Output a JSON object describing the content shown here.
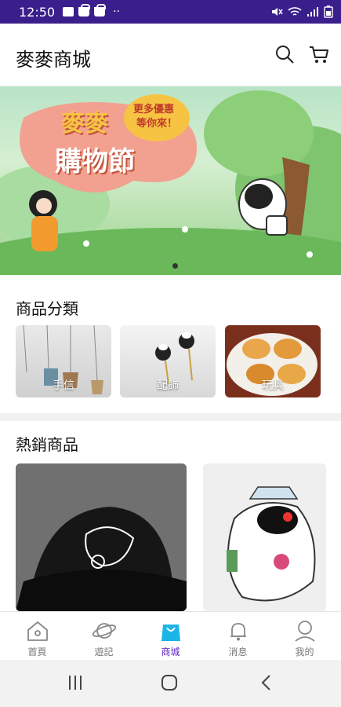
{
  "status_bar": {
    "time": "12:50",
    "dots": "··"
  },
  "header": {
    "title": "麥麥商城"
  },
  "banner": {
    "title_line1": "麥麥",
    "title_line2": "購物節",
    "bubble_line1": "更多優惠",
    "bubble_line2": "等你來！"
  },
  "categories": {
    "title": "商品分類",
    "items": [
      {
        "label": "手信"
      },
      {
        "label": "配飾"
      },
      {
        "label": "玩具"
      }
    ]
  },
  "hot": {
    "title": "熱銷商品"
  },
  "tabs": [
    {
      "label": "首頁",
      "icon": "home-icon"
    },
    {
      "label": "遊記",
      "icon": "planet-icon"
    },
    {
      "label": "商城",
      "icon": "shopping-bag-icon",
      "active": true
    },
    {
      "label": "消息",
      "icon": "bell-icon"
    },
    {
      "label": "我的",
      "icon": "profile-icon"
    }
  ],
  "colors": {
    "statusbar": "#3a1f8c",
    "accent": "#5a22c8",
    "bag": "#1bb5e8"
  }
}
